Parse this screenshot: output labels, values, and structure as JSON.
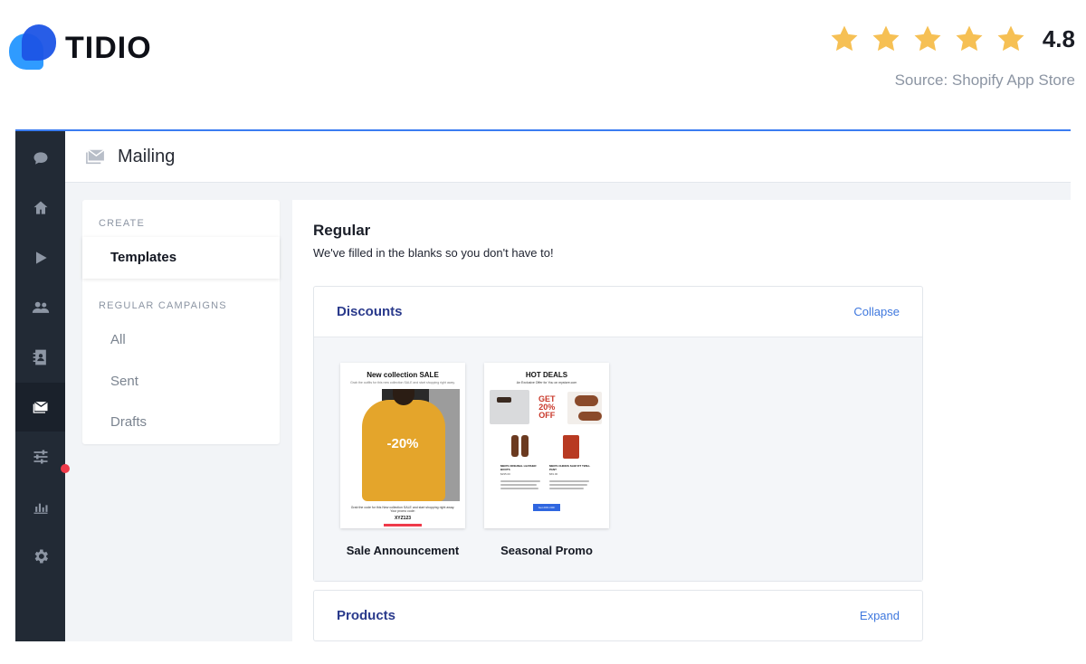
{
  "brand": {
    "name": "TIDIO"
  },
  "rating": {
    "value": "4.8",
    "stars": 5,
    "source": "Source: Shopify App Store",
    "star_color": "#f6c054"
  },
  "app": {
    "accent": "#3a7cf1",
    "rail": {
      "background": "#222a35",
      "items": [
        {
          "icon": "chat-icon",
          "active": false
        },
        {
          "icon": "home-icon",
          "active": false
        },
        {
          "icon": "play-icon",
          "active": false
        },
        {
          "icon": "visitors-icon",
          "active": false
        },
        {
          "icon": "contacts-icon",
          "active": false
        },
        {
          "icon": "mailing-icon",
          "active": true
        },
        {
          "icon": "sliders-icon",
          "active": false
        },
        {
          "icon": "analytics-icon",
          "active": false
        },
        {
          "icon": "settings-icon",
          "active": false
        }
      ]
    },
    "header": {
      "icon": "envelope-icon",
      "title": "Mailing"
    },
    "subnav": {
      "create_label": "CREATE",
      "templates": "Templates",
      "regular_label": "REGULAR CAMPAIGNS",
      "all": "All",
      "sent": "Sent",
      "drafts": "Drafts"
    },
    "main": {
      "title": "Regular",
      "subtitle": "We've filled in the blanks so you don't have to!",
      "panels": [
        {
          "name": "Discounts",
          "toggle": "Collapse",
          "templates": [
            {
              "name": "Sale Announcement",
              "card_title": "New collection SALE",
              "card_sub": "Grab the outfits for this new collection SALE and start shopping right away.",
              "discount": "-20%",
              "footer": "Grab the code for this New collection SALE and start shopping right away. Your promo code:",
              "code": "XYZ123"
            },
            {
              "name": "Seasonal Promo",
              "card_title": "HOT DEALS",
              "card_sub": "An Exclusive Offer for You on mystore.com",
              "offer_lines": [
                "GET",
                "20%",
                "OFF"
              ],
              "product1": "MEN'S ORIGINAL LEATHER BOOTS",
              "price1": "$295.00",
              "product2": "MEN'S CHINOS SLIM FIT TWILL PANT",
              "price2": "$69.00",
              "button": "Get 20% OFF"
            }
          ]
        },
        {
          "name": "Products",
          "toggle": "Expand"
        }
      ]
    },
    "notification_color": "#ef3a4a"
  }
}
